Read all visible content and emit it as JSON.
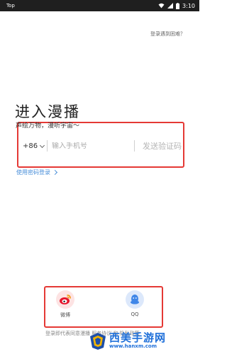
{
  "status_bar": {
    "app_label": "Top",
    "time": "3:10"
  },
  "help_link": "登录遇到困难？",
  "title": "进入漫播",
  "subtitle": "声绘万物，漫听宇宙～",
  "phone": {
    "country_code": "+86",
    "placeholder": "输入手机号",
    "send_code": "发送验证码"
  },
  "password_login": "使用密码登录",
  "social": {
    "weibo_label": "微博",
    "qq_label": "QQ"
  },
  "agreement": "登录即代表同意漫播 服务协议 和 隐私政策",
  "watermark": {
    "title": "西美手游网",
    "url": "www.hanxm.com"
  },
  "colors": {
    "highlight_border": "#e53935",
    "link": "#4a8fd9",
    "weibo": "#e6162d",
    "qq": "#3f86e8",
    "watermark": "#1e6fd9"
  }
}
